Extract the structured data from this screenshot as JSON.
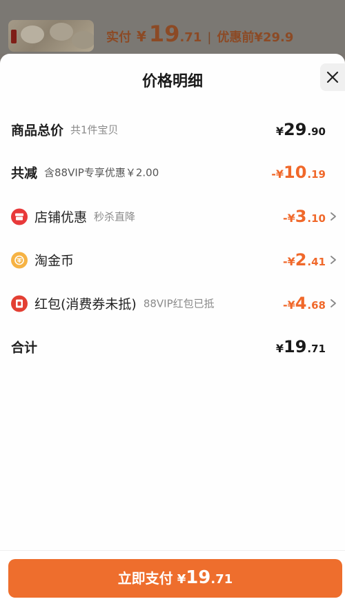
{
  "background": {
    "paid_label": "实付",
    "paid_currency": "¥",
    "paid_int": "19",
    "paid_dec": ".71",
    "separator": "|",
    "original_label": "优惠前¥29.9"
  },
  "sheet": {
    "title": "价格明细",
    "close_icon": "close-icon"
  },
  "rows": {
    "total": {
      "label": "商品总价",
      "sub": "共1件宝贝",
      "currency": "¥",
      "int": "29",
      "dec": ".90"
    },
    "discount": {
      "label": "共减",
      "sub": "含88VIP专享优惠￥2.00",
      "prefix": "-¥",
      "int": "10",
      "dec": ".19"
    },
    "shop": {
      "icon": "shop-icon",
      "label": "店铺优惠",
      "sub": "秒杀直降",
      "prefix": "-¥",
      "int": "3",
      "dec": ".10"
    },
    "coin": {
      "icon": "coin-icon",
      "label": "淘金币",
      "prefix": "-¥",
      "int": "2",
      "dec": ".41"
    },
    "redpack": {
      "icon": "red-envelope-icon",
      "label": "红包(消费券未抵)",
      "sub": "88VIP红包已抵",
      "prefix": "-¥",
      "int": "4",
      "dec": ".68"
    },
    "sum": {
      "label": "合计",
      "currency": "¥",
      "int": "19",
      "dec": ".71"
    }
  },
  "footer": {
    "pay_label": "立即支付",
    "currency": "¥",
    "int": "19",
    "dec": ".71"
  },
  "colors": {
    "accent": "#ee6e2d",
    "discount_text": "#f0682a",
    "shop_icon": "#e8393a",
    "coin_icon": "#f6b344"
  }
}
